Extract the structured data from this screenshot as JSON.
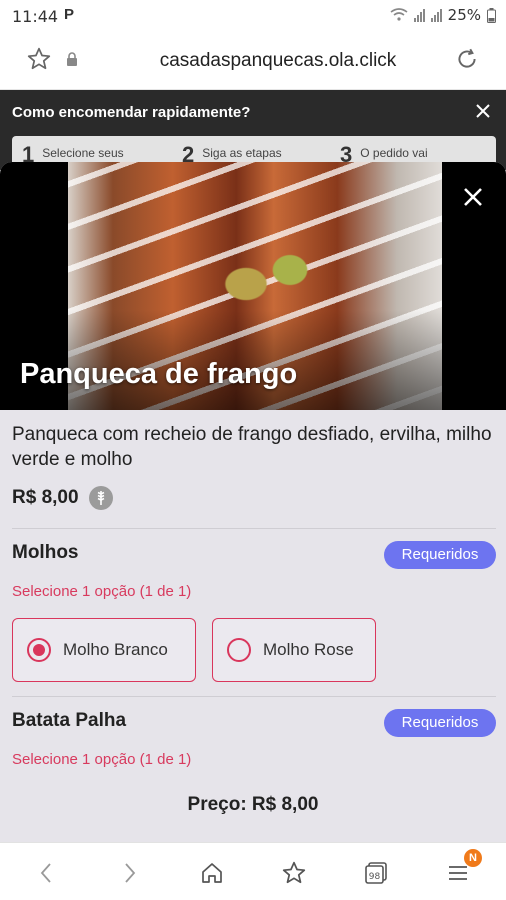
{
  "status_bar": {
    "time": "11:44",
    "app_letter": "P",
    "battery": "25%"
  },
  "browser": {
    "url": "casadaspanquecas.ola.click"
  },
  "banner": {
    "title": "Como encomendar rapidamente?",
    "steps": [
      {
        "num": "1",
        "text": "Selecione seus"
      },
      {
        "num": "2",
        "text": "Siga as etapas"
      },
      {
        "num": "3",
        "text": "O pedido vai"
      }
    ]
  },
  "product": {
    "name": "Panqueca de frango",
    "description": "Panqueca com recheio de frango desfiado, ervilha, milho verde e molho",
    "price": "R$ 8,00"
  },
  "groups": [
    {
      "title": "Molhos",
      "badge": "Requeridos",
      "note": "Selecione 1 opção (1 de 1)",
      "options": [
        {
          "label": "Molho Branco",
          "selected": true
        },
        {
          "label": "Molho Rose",
          "selected": false
        }
      ]
    },
    {
      "title": "Batata Palha",
      "badge": "Requeridos",
      "note": "Selecione 1 opção (1 de 1)",
      "options": []
    }
  ],
  "footer": {
    "total": "Preço: R$ 8,00"
  },
  "bottom_nav": {
    "tabs_count": "98",
    "menu_badge": "N"
  },
  "colors": {
    "accent": "#d9365c",
    "badge": "#6d74f0",
    "modal_bg": "#e6e4ea"
  }
}
